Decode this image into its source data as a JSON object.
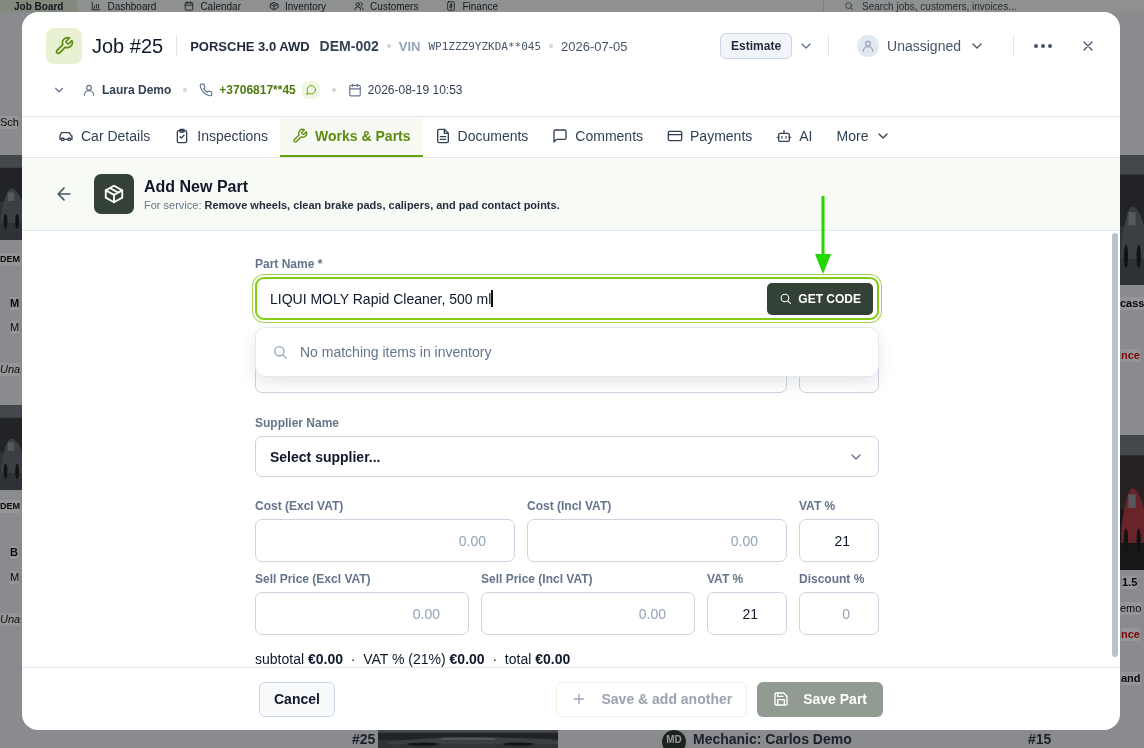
{
  "backdrop": {
    "nav": [
      {
        "label": "Job Board",
        "selected": true
      },
      {
        "label": "Dashboard",
        "selected": false
      },
      {
        "label": "Calendar",
        "selected": false
      },
      {
        "label": "Inventory",
        "selected": false
      },
      {
        "label": "Customers",
        "selected": false
      },
      {
        "label": "Finance",
        "selected": false
      }
    ],
    "search_placeholder": "Search jobs, customers, invoices...",
    "left_fragments": [
      {
        "text": "Sch",
        "kind": "meta"
      },
      {
        "text": "DEM",
        "kind": "plate"
      },
      {
        "text": "M",
        "kind": "title"
      },
      {
        "text": "M",
        "kind": "meta"
      },
      {
        "text": "Una",
        "kind": "italic"
      },
      {
        "text": "DEM",
        "kind": "plate"
      },
      {
        "text": "B",
        "kind": "title"
      },
      {
        "text": "M",
        "kind": "meta"
      },
      {
        "text": "Una",
        "kind": "italic"
      }
    ],
    "right_fragments": [
      {
        "text": "cass",
        "kind": "title"
      },
      {
        "text": "nce",
        "kind": "status"
      },
      {
        "text": "1.5",
        "kind": "title"
      },
      {
        "text": "emo",
        "kind": "meta"
      },
      {
        "text": "nce",
        "kind": "status"
      },
      {
        "text": "and",
        "kind": "title"
      }
    ],
    "bottom": {
      "left_job": "#25",
      "avatar": "MD",
      "mechanic": "Mechanic: Carlos Demo",
      "right_job": "#15"
    }
  },
  "job": {
    "title": "Job #25",
    "car": "PORSCHE 3.0 AWD",
    "plate": "DEM-002",
    "vin_label": "VIN",
    "vin": "WP1ZZZ9YZKDA**045",
    "date": "2026-07-05",
    "status": "Estimate",
    "assignee": "Unassigned",
    "customer": "Laura Demo",
    "phone": "+3706817**45",
    "appointment": "2026-08-19 10:53"
  },
  "tabs": [
    {
      "label": "Car Details",
      "selected": false,
      "kind": "tab"
    },
    {
      "label": "Inspections",
      "selected": false,
      "kind": "tab"
    },
    {
      "label": "Works & Parts",
      "selected": true,
      "kind": "tab"
    },
    {
      "label": "Documents",
      "selected": false,
      "kind": "tab"
    },
    {
      "label": "Comments",
      "selected": false,
      "kind": "tab"
    },
    {
      "label": "Payments",
      "selected": false,
      "kind": "tab"
    },
    {
      "label": "AI",
      "selected": false,
      "kind": "tab"
    },
    {
      "label": "More",
      "selected": false,
      "kind": "dropdown"
    }
  ],
  "panel": {
    "title": "Add New Part",
    "subtitle": "For service: **Remove wheels, clean brake pads, calipers, and pad contact points.**"
  },
  "form": {
    "part_name": {
      "label": "Part Name *",
      "value": "LIQUI MOLY Rapid Cleaner, 500 ml",
      "focused": true,
      "button": "GET CODE"
    },
    "suggestions": {
      "message": "No matching items in inventory"
    },
    "supplier": {
      "label": "Supplier Name",
      "value": "Select supplier..."
    },
    "cost_row": [
      {
        "label": "Cost (Excl VAT)",
        "placeholder": "0.00"
      },
      {
        "label": "Cost (Incl VAT)",
        "placeholder": "0.00"
      },
      {
        "label": "VAT %",
        "value": "21"
      }
    ],
    "sell_row": [
      {
        "label": "Sell Price (Excl VAT)",
        "placeholder": "0.00"
      },
      {
        "label": "Sell Price (Incl VAT)",
        "placeholder": "0.00"
      },
      {
        "label": "VAT %",
        "value": "21"
      },
      {
        "label": "Discount %",
        "placeholder": "0"
      }
    ],
    "summary": "subtotal **€0.00**  ·  VAT % (21%) **€0.00**  ·  total **€0.00**"
  },
  "footer": {
    "cancel": "Cancel",
    "save_another": {
      "label": "Save & add another",
      "disabled": true
    },
    "save": {
      "label": "Save Part",
      "disabled": true
    }
  }
}
